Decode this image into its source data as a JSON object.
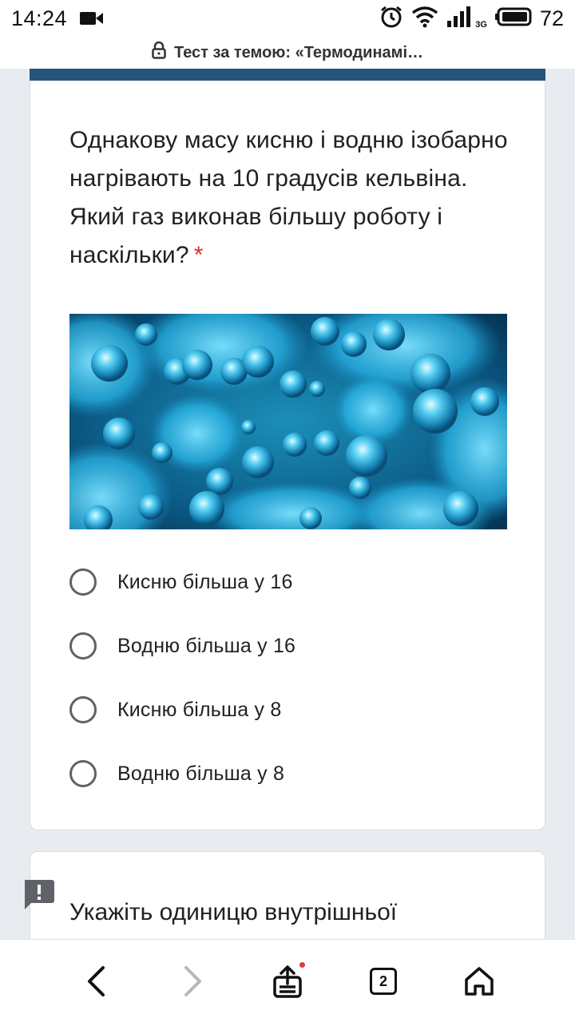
{
  "status_bar": {
    "time": "14:24",
    "network": "3G",
    "battery": "72",
    "icons": [
      "video-icon",
      "alarm-icon",
      "wifi-icon",
      "signal-icon",
      "battery-icon"
    ]
  },
  "url_bar": {
    "title": "Тест за темою: «Термодинамі…",
    "icon": "lock-icon"
  },
  "question_card": {
    "question_text": "Однакову масу кисню і водню ізобарно нагрівають на 10 градусів кельвіна. Який газ виконав більшу роботу і наскільки?",
    "required_mark": "*",
    "accent_color": "#24557d",
    "options": [
      {
        "label": "Кисню більша у 16"
      },
      {
        "label": "Водню більша у 16"
      },
      {
        "label": "Кисню більша у 8"
      },
      {
        "label": "Водню більша у 8"
      }
    ]
  },
  "next_card": {
    "question_text": "Укажіть одиницю внутрішньої"
  },
  "bottom_nav": {
    "tab_count": "2",
    "icons": [
      "back-icon",
      "forward-icon",
      "share-icon",
      "tabs-icon",
      "home-icon"
    ]
  }
}
